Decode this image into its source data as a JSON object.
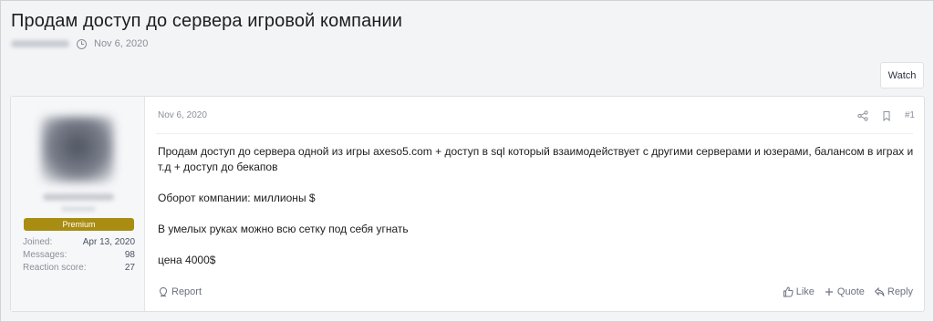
{
  "thread": {
    "title": "Продам доступ до сервера игровой компании",
    "date": "Nov 6, 2020",
    "watch_label": "Watch"
  },
  "user": {
    "badge": "Premium",
    "stats": [
      {
        "label": "Joined:",
        "value": "Apr 13, 2020"
      },
      {
        "label": "Messages:",
        "value": "98"
      },
      {
        "label": "Reaction score:",
        "value": "27"
      }
    ]
  },
  "post": {
    "date": "Nov 6, 2020",
    "number": "#1",
    "paragraphs": [
      "Продам доступ до сервера одной из игры axeso5.com + доступ в sql который взаимодействует с другими серверами и юзерами, балансом в играх и т.д + доступ до бекапов",
      "Оборот компании: миллионы $",
      "В умелых руках можно всю сетку под себя угнать",
      "цена 4000$"
    ],
    "actions": {
      "report": "Report",
      "like": "Like",
      "quote": "Quote",
      "reply": "Reply"
    }
  },
  "colors": {
    "premium_badge": "#a98d12",
    "muted_text": "#8a8f98",
    "page_bg": "#f3f4f6"
  },
  "icons": [
    "clock-icon",
    "share-icon",
    "bookmark-icon",
    "flag-icon",
    "thumbs-up-icon",
    "plus-icon",
    "reply-icon"
  ]
}
